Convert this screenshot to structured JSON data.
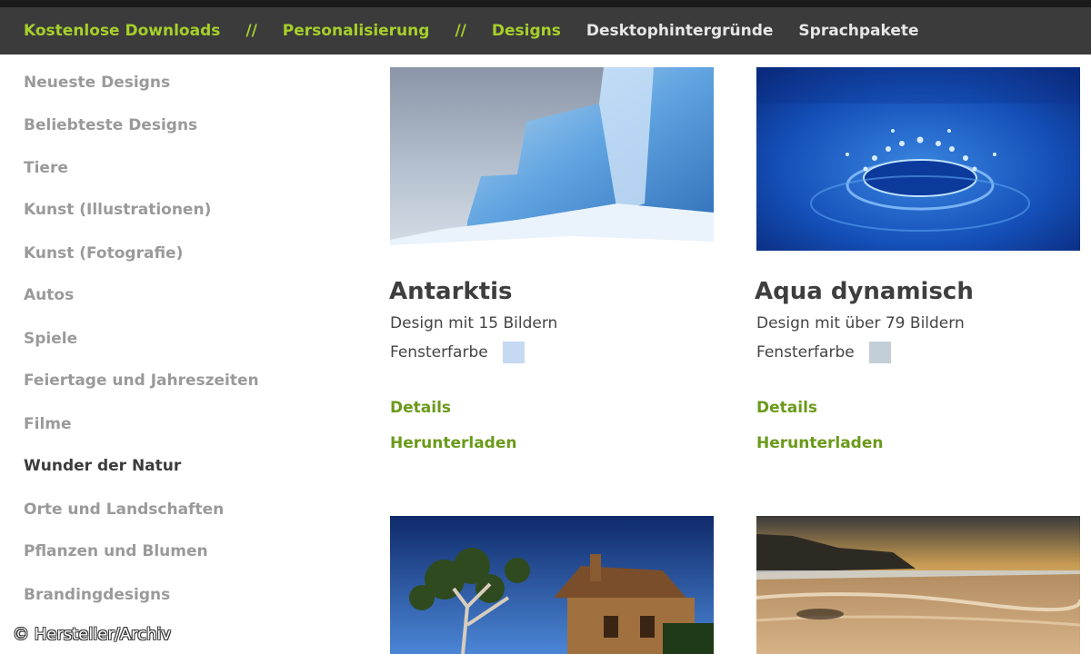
{
  "nav": {
    "items": [
      "Kostenlose Downloads",
      "Personalisierung",
      "Designs",
      "Desktophintergründe",
      "Sprachpakete"
    ],
    "separator": "//"
  },
  "sidebar": {
    "items": [
      "Neueste Designs",
      "Beliebteste Designs",
      "Tiere",
      "Kunst (Illustrationen)",
      "Kunst (Fotografie)",
      "Autos",
      "Spiele",
      "Feiertage und Jahreszeiten",
      "Filme",
      "Wunder der Natur",
      "Orte und Landschaften",
      "Pflanzen und Blumen",
      "Brandingdesigns"
    ],
    "active_index": 9
  },
  "cards": [
    {
      "title": "Antarktis",
      "subtitle": "Design mit 15 Bildern",
      "color_label": "Fensterfarbe",
      "swatch": "#c6d9f3",
      "details": "Details",
      "download": "Herunterladen"
    },
    {
      "title": "Aqua dynamisch",
      "subtitle": "Design mit über 79 Bildern",
      "color_label": "Fensterfarbe",
      "swatch": "#c3ced6",
      "details": "Details",
      "download": "Herunterladen"
    }
  ],
  "watermark": "© Hersteller/Archiv",
  "colors": {
    "nav_bg": "#3b3b3b",
    "nav_accent": "#a6cf2a",
    "link_green": "#6a9a1a"
  }
}
